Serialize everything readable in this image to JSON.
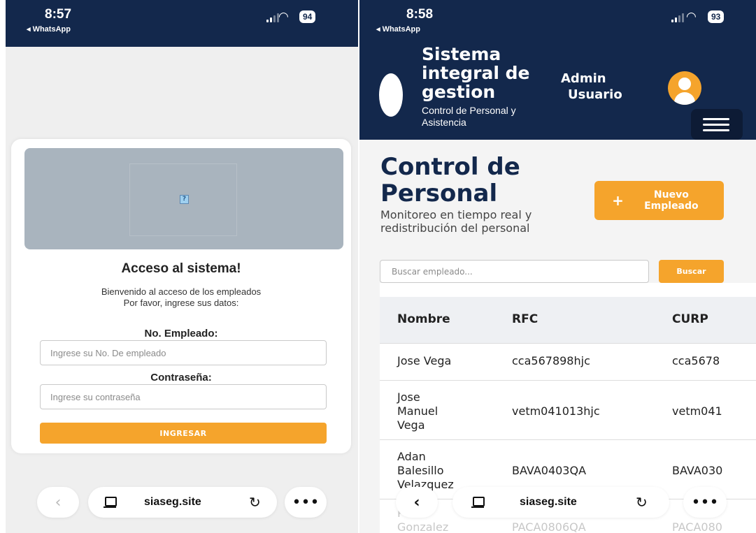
{
  "left_phone": {
    "status": {
      "time": "8:57",
      "back": "◂ WhatsApp",
      "battery": "94"
    },
    "login": {
      "title": "Acceso al sistema!",
      "welcome": "Bienvenido al acceso de los empleados",
      "instruction": "Por favor, ingrese sus datos:",
      "employee_label": "No. Empleado:",
      "employee_placeholder": "Ingrese su No. De empleado",
      "password_label": "Contraseña:",
      "password_placeholder": "Ingrese su contraseña",
      "submit_label": "INGRESAR"
    },
    "browser": {
      "url": "siaseg.site"
    }
  },
  "right_phone": {
    "status": {
      "time": "8:58",
      "back": "◂ WhatsApp",
      "battery": "93"
    },
    "header": {
      "title": "Sistema integral de gestion",
      "subtitle": "Control de Personal y Asistencia",
      "user_line1": "Admin",
      "user_line2": "Usuario"
    },
    "page": {
      "title": "Control de Personal",
      "subtitle": "Monitoreo en tiempo real y redistribución del personal",
      "new_button": "Nuevo Empleado",
      "search_placeholder": "Buscar empleado...",
      "search_button": "Buscar"
    },
    "table": {
      "headers": [
        "Nombre",
        "RFC",
        "CURP"
      ],
      "rows": [
        {
          "nombre": "Jose Vega",
          "rfc": "cca567898hjc",
          "curp": "cca5678"
        },
        {
          "nombre": "Jose\nManuel\nVega",
          "rfc": "vetm041013hjc",
          "curp": "vetm041"
        },
        {
          "nombre": "Adan\nBalesillo\nVelazquez",
          "rfc": "BAVA0403QA",
          "curp": "BAVA030"
        },
        {
          "nombre": "Pedro\nGonzalez",
          "rfc": "PACA0806QA",
          "curp": "PACA080"
        }
      ]
    },
    "browser": {
      "url": "siaseg.site"
    }
  },
  "colors": {
    "navy": "#13284c",
    "accent": "#f5a42c"
  }
}
